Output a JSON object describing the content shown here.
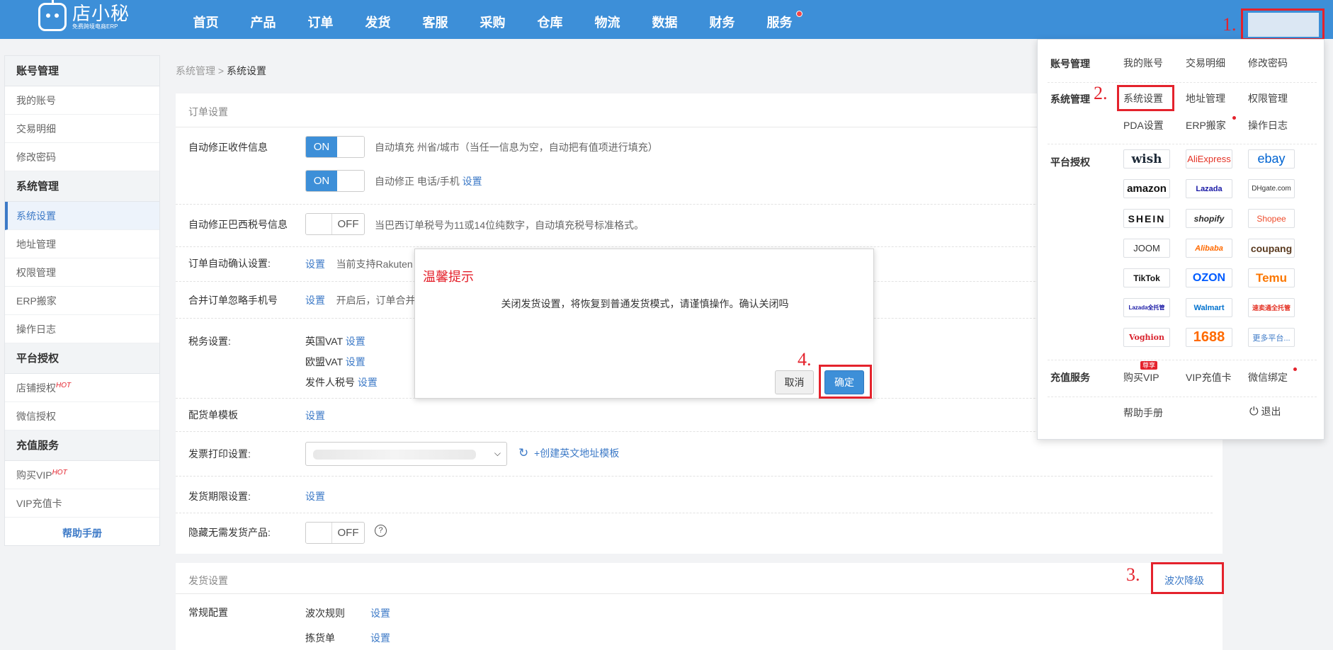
{
  "topnav": {
    "logo_text": "店小秘",
    "logo_sub": "免费跨境电商ERP",
    "items": [
      "首页",
      "产品",
      "订单",
      "发货",
      "客服",
      "采购",
      "仓库",
      "物流",
      "数据",
      "财务",
      "服务"
    ]
  },
  "steps": [
    "1.",
    "2.",
    "3.",
    "4."
  ],
  "sidebar": {
    "groups": [
      {
        "title": "账号管理",
        "items": [
          "我的账号",
          "交易明细",
          "修改密码"
        ]
      },
      {
        "title": "系统管理",
        "items": [
          "系统设置",
          "地址管理",
          "权限管理",
          "ERP搬家",
          "操作日志"
        ]
      },
      {
        "title": "平台授权",
        "items": [
          "店铺授权",
          "微信授权"
        ]
      },
      {
        "title": "充值服务",
        "items": [
          "购买VIP",
          "VIP充值卡"
        ]
      }
    ],
    "hot": "HOT",
    "help": "帮助手册"
  },
  "breadcrumb": {
    "parent": "系统管理",
    "sep": " > ",
    "current": "系统设置"
  },
  "order_settings": {
    "title": "订单设置",
    "auto_fix_recipient": "自动修正收件信息",
    "auto_fill_desc": "自动填充 州省/城市（当任一信息为空，自动把有值项进行填充）",
    "auto_fix_phone_desc": "自动修正 电话/手机",
    "auto_fix_brazil": "自动修正巴西税号信息",
    "brazil_desc": "当巴西订单税号为11或14位纯数字，自动填充税号标准格式。",
    "auto_confirm": "订单自动确认设置:",
    "auto_confirm_desc": "当前支持Rakuten",
    "merge_ignore": "合并订单忽略手机号",
    "merge_desc": "开启后，订单合并",
    "tax_label": "税务设置:",
    "tax_uk": "英国VAT",
    "tax_eu": "欧盟VAT",
    "tax_sender": "发件人税号",
    "packing_template": "配货单模板",
    "invoice_print": "发票打印设置:",
    "create_en_template": "+创建英文地址模板",
    "ship_deadline": "发货期限设置:",
    "hide_no_ship": "隐藏无需发货产品:",
    "set_link": "设置",
    "on": "ON",
    "off": "OFF",
    "q": "?"
  },
  "shipping_settings": {
    "title": "发货设置",
    "wave_downgrade": "波次降级",
    "regular_config": "常规配置",
    "wave_rule": "波次规则",
    "pick_list": "拣货单",
    "set_link": "设置"
  },
  "dialog": {
    "title": "温馨提示",
    "message": "关闭发货设置，将恢复到普通发货模式，请谨慎操作。确认关闭吗",
    "cancel": "取消",
    "confirm": "确定"
  },
  "user_menu": {
    "account_label": "账号管理",
    "account_items": [
      "我的账号",
      "交易明细",
      "修改密码"
    ],
    "system_label": "系统管理",
    "system_items": [
      "系统设置",
      "地址管理",
      "权限管理",
      "PDA设置",
      "ERP搬家",
      "操作日志"
    ],
    "platform_label": "平台授权",
    "platforms": [
      "wish",
      "AliExpress",
      "ebay",
      "amazon",
      "Lazada",
      "DHgate.com",
      "SHEIN",
      "shopify",
      "Shopee",
      "JOOM",
      "Alibaba",
      "coupang",
      "TikTok",
      "OZON",
      "Temu",
      "Lazada全托管",
      "Walmart",
      "速卖通全托管",
      "Voghion",
      "1688",
      "更多平台..."
    ],
    "recharge_label": "充值服务",
    "recharge_items": [
      "购买VIP",
      "VIP充值卡",
      "微信绑定"
    ],
    "vip_tag": "尊享",
    "help": "帮助手册",
    "logout": "退出"
  },
  "colors": {
    "primary": "#3d8fd8",
    "highlight": "#e4222c",
    "link": "#3d7ac7"
  }
}
